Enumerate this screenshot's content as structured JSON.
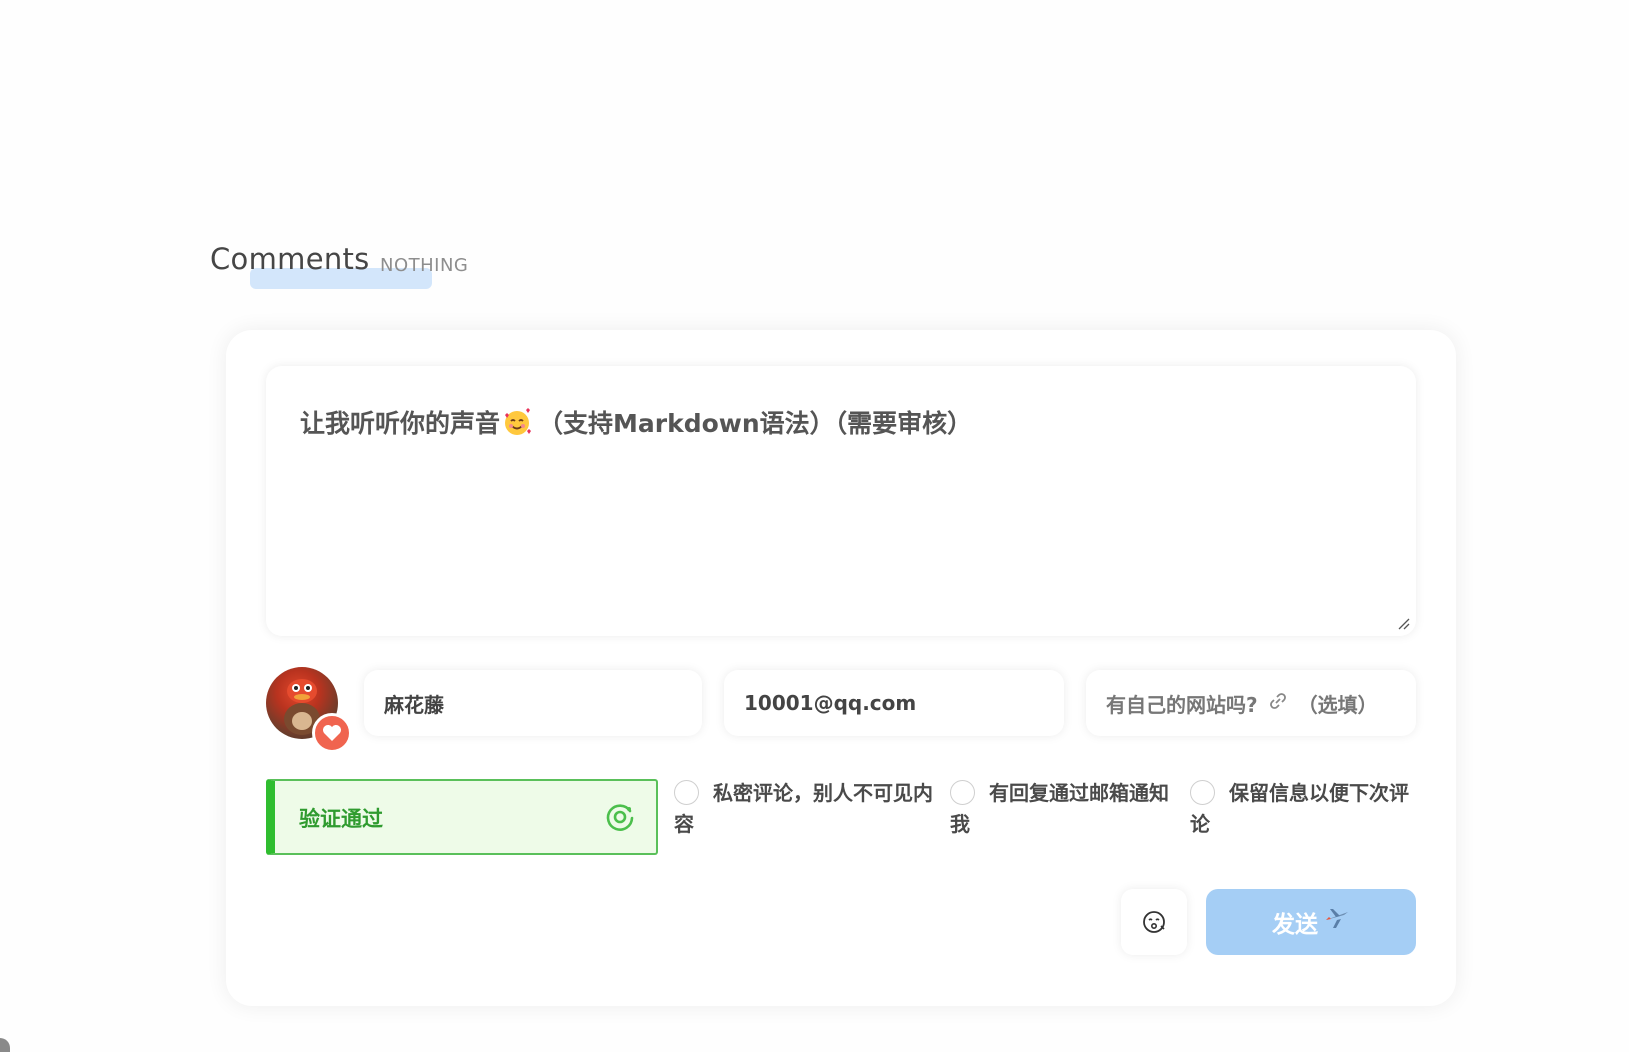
{
  "heading": {
    "title": "Comments",
    "subtitle": "NOTHING"
  },
  "composer": {
    "placeholder_before": "让我听听你的声音",
    "placeholder_emoji": "smiling-face-with-hearts",
    "placeholder_after": "（支持Markdown语法）（需要审核）"
  },
  "user": {
    "avatar": "avatar",
    "badge_icon": "heart-icon",
    "name_value": "麻花藤",
    "email_value": "10001@qq.com",
    "website_placeholder_before": "有自己的网站吗?",
    "website_icon": "link-icon",
    "website_placeholder_after": "（选填）"
  },
  "verify": {
    "label": "验证通过",
    "icon": "refresh-icon",
    "color": "#2fbd2f"
  },
  "options": [
    {
      "label": "私密评论，别人不可见内容",
      "checked": false
    },
    {
      "label": "有回复通过邮箱通知我",
      "checked": false
    },
    {
      "label": "保留信息以便下次评论",
      "checked": false
    }
  ],
  "actions": {
    "emoji_icon": "emoji-icon",
    "send_label": "发送",
    "send_icon": "airplane-icon",
    "send_color": "#a5cef5"
  }
}
